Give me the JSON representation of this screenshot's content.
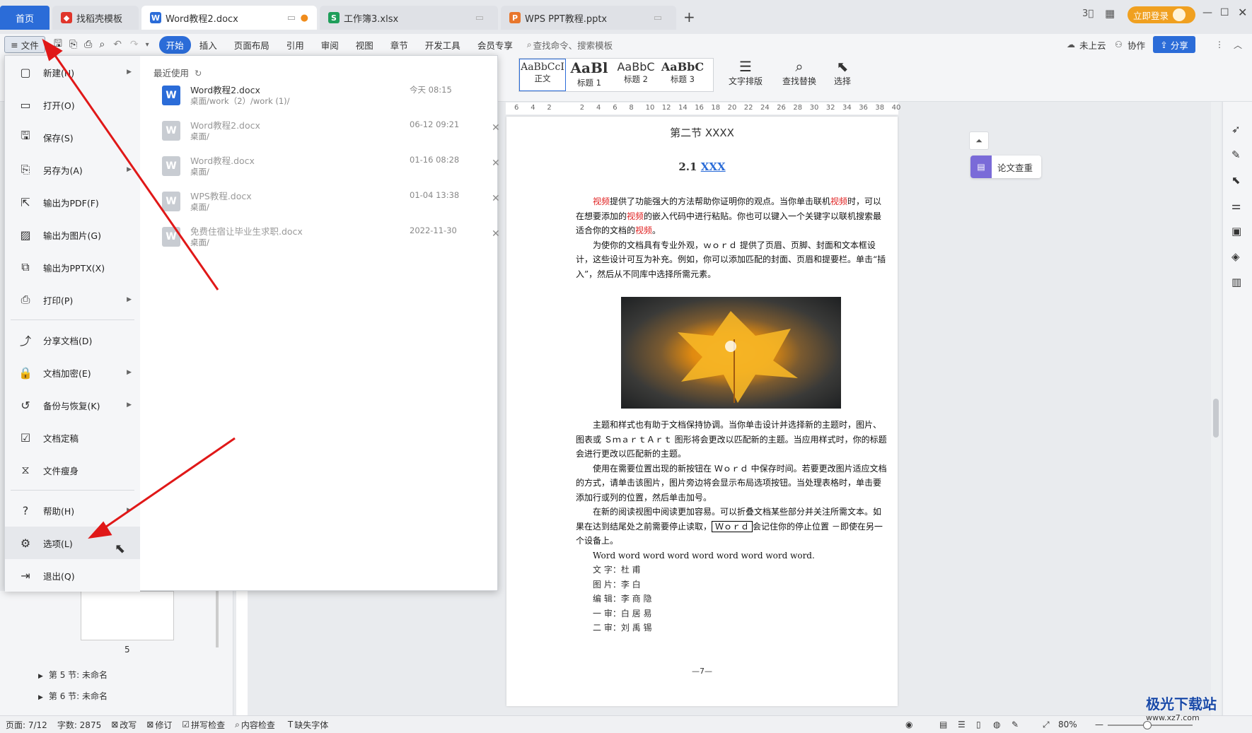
{
  "tabs": {
    "home": "首页",
    "template": "找稻壳模板",
    "doc": "Word教程2.docx",
    "xlsx": "工作簿3.xlsx",
    "pptx": "WPS PPT教程.pptx",
    "add": "+",
    "login": "立即登录"
  },
  "menubar": {
    "file": "文件",
    "items": [
      "开始",
      "插入",
      "页面布局",
      "引用",
      "审阅",
      "视图",
      "章节",
      "开发工具",
      "会员专享"
    ],
    "search": "查找命令、搜索模板",
    "cloud": "未上云",
    "collab": "协作",
    "share": "分享"
  },
  "ribbon": {
    "styles": [
      {
        "preview": "AaBbCcI",
        "label": "正文"
      },
      {
        "preview": "AaBl",
        "label": "标题 1"
      },
      {
        "preview": "AaBbC",
        "label": "标题 2"
      },
      {
        "preview": "AaBbC",
        "label": "标题 3"
      }
    ],
    "text_layout": "文字排版",
    "find_replace": "查找替换",
    "select": "选择"
  },
  "ruler_ticks": [
    "6",
    "4",
    "2",
    "",
    "2",
    "4",
    "6",
    "8",
    "10",
    "12",
    "14",
    "16",
    "18",
    "20",
    "22",
    "24",
    "26",
    "28",
    "30",
    "32",
    "34",
    "36",
    "38",
    "40"
  ],
  "file_menu": {
    "items": [
      {
        "label": "新建(N)",
        "icon": "new-icon",
        "arrow": true
      },
      {
        "label": "打开(O)",
        "icon": "open-icon",
        "arrow": false
      },
      {
        "label": "保存(S)",
        "icon": "save-icon",
        "arrow": false
      },
      {
        "label": "另存为(A)",
        "icon": "save-as-icon",
        "arrow": true
      },
      {
        "label": "输出为PDF(F)",
        "icon": "pdf-icon",
        "arrow": false
      },
      {
        "label": "输出为图片(G)",
        "icon": "image-icon",
        "arrow": false
      },
      {
        "label": "输出为PPTX(X)",
        "icon": "pptx-icon",
        "arrow": false
      },
      {
        "label": "打印(P)",
        "icon": "print-icon",
        "arrow": true
      },
      {
        "label": "分享文档(D)",
        "icon": "share-icon",
        "arrow": false
      },
      {
        "label": "文档加密(E)",
        "icon": "lock-icon",
        "arrow": true
      },
      {
        "label": "备份与恢复(K)",
        "icon": "backup-icon",
        "arrow": true
      },
      {
        "label": "文档定稿",
        "icon": "finalize-icon",
        "arrow": false
      },
      {
        "label": "文件瘦身",
        "icon": "slim-icon",
        "arrow": false
      },
      {
        "label": "帮助(H)",
        "icon": "help-icon",
        "arrow": true
      },
      {
        "label": "选项(L)",
        "icon": "gear-icon",
        "arrow": false
      },
      {
        "label": "退出(Q)",
        "icon": "exit-icon",
        "arrow": false
      }
    ],
    "recent_title": "最近使用",
    "recent": [
      {
        "name": "Word教程2.docx",
        "path": "桌面/work（2）/work (1)/",
        "time": "今天  08:15",
        "active": true
      },
      {
        "name": "Word教程2.docx",
        "path": "桌面/",
        "time": "06-12 09:21",
        "active": false
      },
      {
        "name": "Word教程.docx",
        "path": "桌面/",
        "time": "01-16 08:28",
        "active": false
      },
      {
        "name": "WPS教程.docx",
        "path": "桌面/",
        "time": "01-04 13:38",
        "active": false
      },
      {
        "name": "免费住宿让毕业生求职.docx",
        "path": "桌面/",
        "time": "2022-11-30",
        "active": false
      }
    ]
  },
  "doc": {
    "section": "第二节  XXXX",
    "heading_num": "2.1",
    "heading_link": "XXX",
    "p1a": "视频",
    "p1b": "提供了功能强大的方法帮助你证明你的观点。当你单击联机",
    "p1c": "视频",
    "p1d": "时，可以在想要添加的",
    "p1e": "视频",
    "p1f": "的嵌入代码中进行粘贴。你也可以键入一个关键字以联机搜索最适合你的文档的",
    "p1g": "视频",
    "p1h": "。",
    "p2": "为使你的文档具有专业外观，ｗｏｒｄ  提供了页眉、页脚、封面和文本框设计，这些设计可互为补充。例如，你可以添加匹配的封面、页眉和提要栏。单击“插入”，然后从不同库中选择所需元素。",
    "p3": "主题和样式也有助于文档保持协调。当你单击设计并选择新的主题时，图片、图表或 ＳｍａｒｔＡｒｔ 图形将会更改以匹配新的主题。当应用样式时，你的标题会进行更改以匹配新的主题。",
    "p4": "使用在需要位置出现的新按钮在  Ｗｏｒｄ  中保存时间。若要更改图片适应文档的方式，请单击该图片，图片旁边将会显示布局选项按钮。当处理表格时，单击要添加行或列的位置，然后单击加号。",
    "p5a": "在新的阅读视图中阅读更加容易。可以折叠文档某些部分并关注所需文本。如果在达到结尾处之前需要停止读取，",
    "p5box": "Ｗｏｒｄ",
    "p5b": "会记住你的停止位置  －即使在另一个设备上。",
    "p6": "Word word word word word word word word word.",
    "credits": [
      "文 字：杜    甫",
      "图 片：李    白",
      "编 辑：李 商 隐",
      "一 审：白 居 易",
      "二 审：刘 禹 锡"
    ],
    "page_num": "—7—"
  },
  "nav": {
    "page_label": "5",
    "sec5": "第 5 节: 未命名",
    "sec6": "第 6 节: 未命名"
  },
  "side_panel": {
    "paper_check": "论文查重"
  },
  "status": {
    "page": "页面: 7/12",
    "words": "字数: 2875",
    "revise": "改写",
    "track": "修订",
    "spell": "拼写检查",
    "content": "内容检查",
    "missing_font": "缺失字体",
    "zoom": "80%"
  },
  "watermark": {
    "brand": "极光下载站",
    "url": "www.xz7.com"
  },
  "colors": {
    "accent": "#2b6cd8",
    "arrow": "#e01818",
    "login": "#f0a020"
  }
}
